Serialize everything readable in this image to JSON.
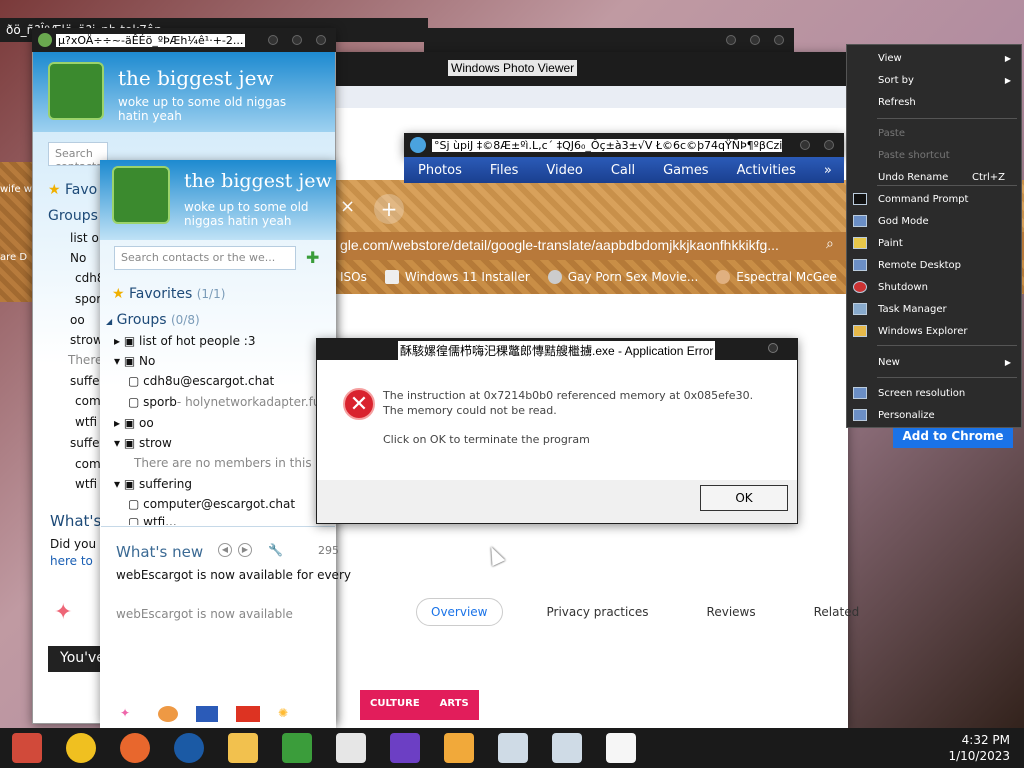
{
  "windows": {
    "back_title": "µ?xOÄ÷÷~-äÊÉö_ºÞÆh¼ê¹·+-2...",
    "top_title": "ðö_ñ?ÎºÆlö_ä?i_nb tok7âp...",
    "photo_viewer": "Windows Photo Viewer",
    "games_title": "°Sj ùpiJ ‡©8Æ±ºì.L,c´ ‡QJ6₀_Ôç±à3±√V Ł©6c©þ74qŸÑÞ¶ºβCzi1...",
    "games_menu": [
      "Photos",
      "Files",
      "Video",
      "Call",
      "Games",
      "Activities",
      "»"
    ]
  },
  "chrome": {
    "address": "gle.com/webstore/detail/google-translate/aapbdbdomjkkjkaonfhkkikfg...",
    "bookmarks": [
      "ISOs",
      "Windows 11 Installer",
      "Gay Porn Sex Movie...",
      "Espectral McGee"
    ],
    "store_tabs": [
      "Overview",
      "Privacy practices",
      "Reviews",
      "Related"
    ],
    "culture_tags": [
      "CULTURE",
      "ARTS"
    ],
    "add_button": "Add to Chrome",
    "tab_close": "×",
    "tab_add": "+"
  },
  "messenger_back": {
    "name": "the biggest jew",
    "status": "woke up to some old niggas hatin yeah",
    "search_placeholder": "Search contacts or the we...",
    "favorites": "Favo",
    "groups": "Groups",
    "contacts": [
      "list o",
      "No",
      "cdh8",
      "sporb",
      "oo",
      "strow",
      "There",
      "suffe",
      "comp",
      "wtfi",
      "suffe",
      "comp",
      "wtfi"
    ],
    "whats_new": "What's",
    "did_you": "Did you k",
    "here_to": "here to",
    "youve": "You've",
    "side_text_1": "wife w",
    "side_text_2": "are D"
  },
  "messenger_front": {
    "name": "the biggest jew",
    "status": "woke up to some old niggas hatin yeah",
    "search_placeholder": "Search contacts or the we...",
    "favorites": "Favorites",
    "favorites_count": "(1/1)",
    "groups": "Groups",
    "groups_count": "(0/8)",
    "tree": [
      "list of hot people :3",
      "No",
      "cdh8u@escargot.chat",
      "sporb",
      "- holynetworkadapter.fun",
      "oo",
      "strow",
      "There are no members in this gr",
      "suffering",
      "computer@escargot.chat",
      "wtfi..."
    ],
    "whats_new": "What's new",
    "news_count": "295",
    "news_1": "webEscargot is now available for every",
    "news_2": "webEscargot is now available"
  },
  "error_dialog": {
    "title": "酥駭嫘徨儒栉嗨汜稞鼈郎慱黠艘檵擄.exe - Application Error",
    "message": "The instruction at 0x7214b0b0 referenced memory at 0x085efe30. The memory could not be read.",
    "message2": "Click on OK to terminate the program",
    "ok": "OK",
    "icon": "error-x-icon"
  },
  "context_menu": {
    "items": [
      {
        "label": "View",
        "arrow": true,
        "disabled": false
      },
      {
        "label": "Sort by",
        "arrow": true,
        "disabled": false
      },
      {
        "label": "Refresh",
        "disabled": false
      },
      {
        "label": "Paste",
        "disabled": true
      },
      {
        "label": "Paste shortcut",
        "disabled": true
      },
      {
        "label": "Undo Rename",
        "shortcut": "Ctrl+Z",
        "disabled": false
      },
      {
        "label": "Command Prompt",
        "icon": "cmd-icon",
        "disabled": false
      },
      {
        "label": "God Mode",
        "icon": "godmode-icon",
        "disabled": false
      },
      {
        "label": "Paint",
        "icon": "paint-icon",
        "disabled": false
      },
      {
        "label": "Remote Desktop",
        "icon": "rdp-icon",
        "disabled": false
      },
      {
        "label": "Shutdown",
        "icon": "shutdown-icon",
        "disabled": false
      },
      {
        "label": "Task Manager",
        "icon": "taskmgr-icon",
        "disabled": false
      },
      {
        "label": "Windows Explorer",
        "icon": "explorer-icon",
        "disabled": false
      },
      {
        "label": "New",
        "arrow": true,
        "disabled": false
      },
      {
        "label": "Screen resolution",
        "icon": "display-icon",
        "disabled": false
      },
      {
        "label": "Personalize",
        "icon": "personalize-icon",
        "disabled": false
      }
    ]
  },
  "taskbar": {
    "icons": [
      "start-orb-icon",
      "chrome-icon",
      "firefox-icon",
      "obama-logo-icon",
      "file-explorer-icon",
      "messenger-icon",
      "7zip-icon",
      "paint-colors-icon",
      "media-player-icon",
      "notepad-icon",
      "notepad2-icon",
      "blank-doc-icon"
    ],
    "colors": [
      "#d14a3a",
      "#f0c020",
      "#e8672d",
      "#1b5aa5",
      "#f2c14e",
      "#3b9d3b",
      "#e6e6e6",
      "#6c3fc4",
      "#f1a93a",
      "#cfdbe6",
      "#cfdbe6",
      "#f6f6f6"
    ],
    "time": "4:32 PM",
    "date": "1/10/2023"
  }
}
